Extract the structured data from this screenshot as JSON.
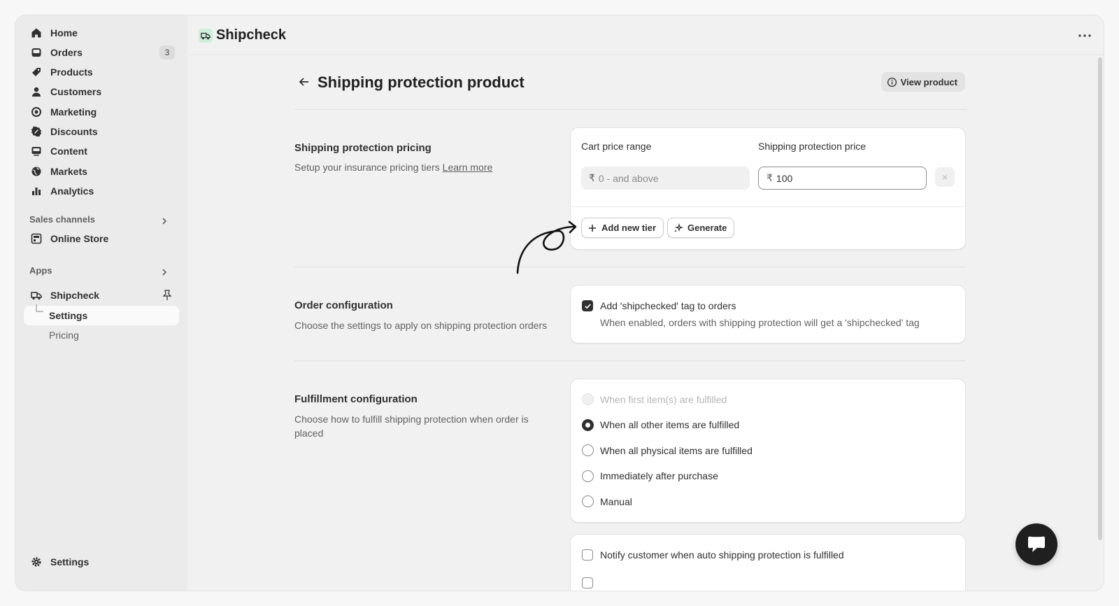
{
  "sidebar": {
    "items": [
      {
        "label": "Home",
        "icon": "home-icon"
      },
      {
        "label": "Orders",
        "icon": "inbox-icon",
        "badge": "3"
      },
      {
        "label": "Products",
        "icon": "tag-icon"
      },
      {
        "label": "Customers",
        "icon": "person-icon"
      },
      {
        "label": "Marketing",
        "icon": "target-icon"
      },
      {
        "label": "Discounts",
        "icon": "discount-icon"
      },
      {
        "label": "Content",
        "icon": "content-icon"
      },
      {
        "label": "Markets",
        "icon": "globe-icon"
      },
      {
        "label": "Analytics",
        "icon": "bar-chart-icon"
      }
    ],
    "sales_channels_label": "Sales channels",
    "online_store_label": "Online Store",
    "apps_label": "Apps",
    "app_name": "Shipcheck",
    "app_settings_label": "Settings",
    "app_pricing_label": "Pricing",
    "settings_label": "Settings"
  },
  "topbar": {
    "app_title": "Shipcheck"
  },
  "page": {
    "title": "Shipping protection product",
    "view_product_label": "View product"
  },
  "pricing": {
    "title": "Shipping protection pricing",
    "desc": "Setup your insurance pricing tiers",
    "learn_more": "Learn more",
    "col_range": "Cart price range",
    "col_price": "Shipping protection price",
    "currency": "₹",
    "range_value": "0 -  and above",
    "price_value": "100",
    "remove": "×",
    "add_tier_label": "Add new tier",
    "generate_label": "Generate"
  },
  "order_config": {
    "title": "Order configuration",
    "desc": "Choose the settings to apply on shipping protection orders",
    "tag_label": "Add 'shipchecked' tag to orders",
    "tag_help": "When enabled, orders with shipping protection will get a 'shipchecked' tag",
    "tag_checked": true
  },
  "fulfillment": {
    "title": "Fulfillment configuration",
    "desc": "Choose how to fulfill shipping protection when order is placed",
    "options": [
      {
        "label": "When first item(s) are fulfilled",
        "state": "disabled"
      },
      {
        "label": "When all other items are fulfilled",
        "state": "selected"
      },
      {
        "label": "When all physical items are fulfilled",
        "state": "unselected"
      },
      {
        "label": "Immediately after purchase",
        "state": "unselected"
      },
      {
        "label": "Manual",
        "state": "unselected"
      }
    ],
    "notify_label": "Notify customer when auto shipping protection is fulfilled"
  },
  "colors": {
    "sidebar_bg": "#ebebeb",
    "main_bg": "#f1f1f1",
    "card_bg": "#ffffff",
    "logo_bg": "#cdeed7",
    "text": "#303030"
  }
}
